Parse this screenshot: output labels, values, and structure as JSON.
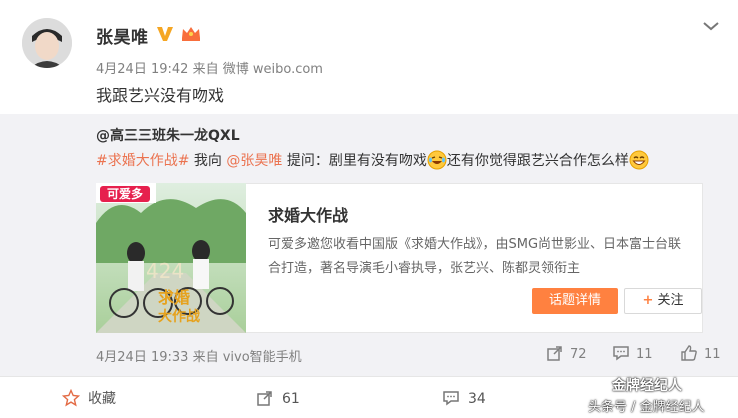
{
  "post": {
    "author": "张昊唯",
    "time": "4月24日 19:42",
    "via_label": "来自",
    "source": "微博 weibo.com",
    "text": "我跟艺兴没有吻戏"
  },
  "repost": {
    "author": "@高三三班朱一龙QXL",
    "hashtag": "#求婚大作战#",
    "text_1": " 我向 ",
    "mention": "@张昊唯",
    "text_2": " 提问：剧里有没有吻戏",
    "text_3": "还有你觉得跟艺兴合作怎么样",
    "card": {
      "poster_brand": "可爱多",
      "poster_num": "424",
      "poster_title_1": "求婚",
      "poster_title_2": "大作战",
      "title": "求婚大作战",
      "description": "可爱多邀您收看中国版《求婚大作战》，由SMG尚世影业、日本富士台联合打造，著名导演毛小睿执导，张艺兴、陈都灵领衔主",
      "detail_button": "话题详情",
      "follow_button": "关注"
    },
    "time": "4月24日 19:33",
    "via_label": "来自",
    "source": "vivo智能手机",
    "shares": "72",
    "comments": "11",
    "likes": "11"
  },
  "actions": {
    "favorite": "收藏",
    "shares": "61",
    "comments": "34"
  },
  "watermark": {
    "line1": "金牌经纪人",
    "line2": "头条号 / 金牌经纪人"
  },
  "colors": {
    "link": "#eb7350",
    "accent_button": "#ff8140",
    "repost_bg": "#f2f2f5"
  }
}
